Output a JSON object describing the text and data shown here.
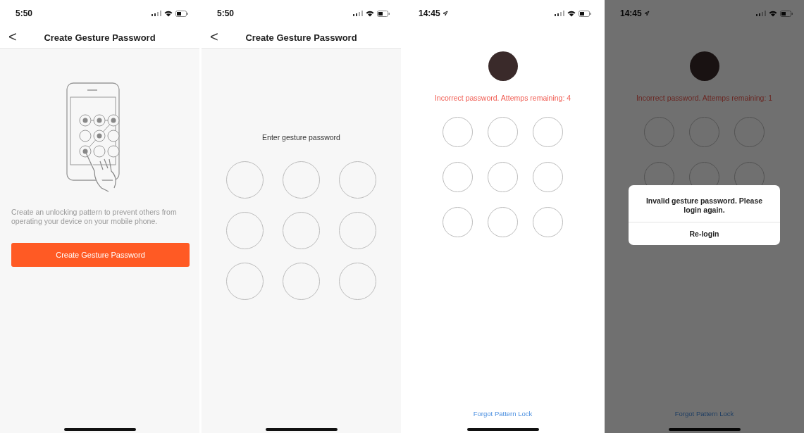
{
  "screens": [
    {
      "kind": "intro",
      "status": {
        "time": "5:50",
        "location_arrow": false
      },
      "nav": {
        "back": "<",
        "title": "Create Gesture Password"
      },
      "description": "Create an unlocking pattern to prevent others from operating your device on your mobile phone.",
      "button": "Create Gesture Password"
    },
    {
      "kind": "create",
      "status": {
        "time": "5:50",
        "location_arrow": false
      },
      "nav": {
        "back": "<",
        "title": "Create Gesture Password"
      },
      "prompt": "Enter gesture password"
    },
    {
      "kind": "verify",
      "status": {
        "time": "14:45",
        "location_arrow": true
      },
      "error": "Incorrect password. Attemps remaining: 4",
      "link": "Forgot Pattern Lock",
      "dimmed": false
    },
    {
      "kind": "verify",
      "status": {
        "time": "14:45",
        "location_arrow": true
      },
      "error": "Incorrect password. Attemps remaining: 1",
      "link": "Forgot Pattern Lock",
      "dimmed": true,
      "dialog": {
        "message": "Invalid gesture password. Please login again.",
        "button": "Re-login"
      }
    }
  ]
}
